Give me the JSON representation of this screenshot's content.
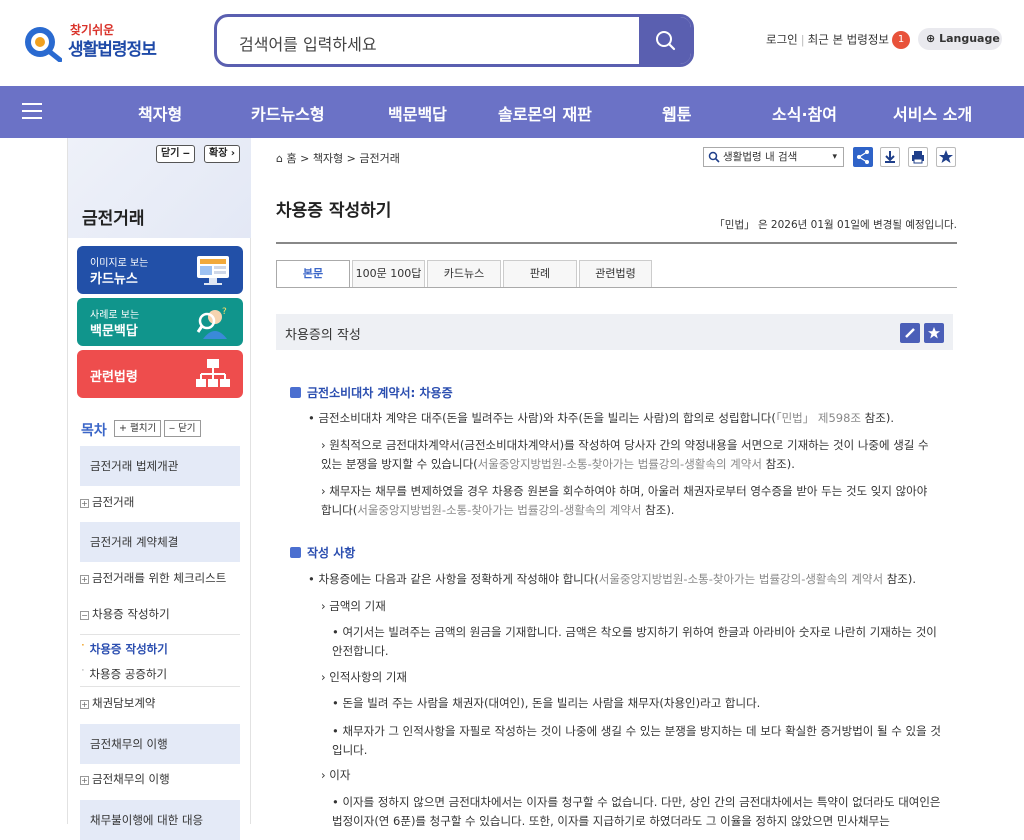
{
  "header": {
    "logo_top": "찾기쉬운",
    "logo_main": "생활법령정보",
    "search_placeholder": "검색어를 입력하세요",
    "login": "로그인",
    "recent": "최근 본 법령정보",
    "recent_count": "1",
    "language": "Language"
  },
  "nav": [
    "책자형",
    "카드뉴스형",
    "백문백답",
    "솔로몬의 재판",
    "웹툰",
    "소식·참여",
    "서비스 소개"
  ],
  "sidebar": {
    "close_label": "닫기 ‒",
    "expand_label": "확장 ›",
    "title": "금전거래",
    "cards": [
      {
        "small": "이미지로 보는",
        "big": "카드뉴스",
        "color": "#2250a8"
      },
      {
        "small": "사례로 보는",
        "big": "백문백답",
        "color": "#10958c"
      },
      {
        "small": "",
        "big": "관련법령",
        "color": "#ee4d4d"
      }
    ],
    "toc_label": "목차",
    "unfold_label": "+ 펼치기",
    "fold_label": "‒ 닫기",
    "sections": [
      "금전거래 법제개관",
      "금전거래 계약체결",
      "금전채무의 이행",
      "채무불이행에 대한 대응"
    ],
    "items": [
      "금전거래",
      "금전거래를 위한 체크리스트",
      "차용증 작성하기",
      "차용증 작성하기",
      "차용증 공증하기",
      "채권담보계약",
      "금전채무의 이행"
    ]
  },
  "main": {
    "breadcrumb": "홈 > 책자형 > 금전거래",
    "search_select": "생활법령 내 검색",
    "title": "차용증 작성하기",
    "notice": "「민법」 은 2026년 01월 01일에 변경될 예정입니다.",
    "tabs": [
      "본문",
      "100문 100답",
      "카드뉴스",
      "판례",
      "관련법령"
    ],
    "section_title": "차용증의 작성",
    "h_contract": "금전소비대차 계약서: 차용증",
    "p1": "금전소비대차 계약은 대주(돈을 빌려주는 사람)와 차주(돈을 빌리는 사람)의 합의로 성립합니다(",
    "p1_ref": "「민법」 제598조",
    "p1_end": " 참조).",
    "p2": "원칙적으로 금전대차계약서(금전소비대차계약서)를 작성하여 당사자 간의 약정내용을 서면으로 기재하는 것이 나중에 생길 수 있는 분쟁을 방지할 수 있습니다(",
    "p2_ref": "서울중앙지방법원-소통-찾아가는 법률강의-생활속의 계약서",
    "p2_end": " 참조).",
    "p3": "채무자는 채무를 변제하였을 경우 차용증 원본을 회수하여야 하며, 아울러 채권자로부터 영수증을 받아 두는 것도 잊지 않아야 합니다(",
    "p3_ref": "서울중앙지방법원-소통-찾아가는 법률강의-생활속의 계약서",
    "p3_end": " 참조).",
    "h_items": "작성 사항",
    "p4": "차용증에는 다음과 같은 사항을 정확하게 작성해야 합니다(",
    "p4_ref": "서울중앙지방법원-소통-찾아가는 법률강의-생활속의 계약서",
    "p4_end": " 참조).",
    "s1": "금액의 기재",
    "s1p": "여기서는 빌려주는 금액의 원금을 기재합니다. 금액은 착오를 방지하기 위하여 한글과 아라비아 숫자로 나란히 기재하는 것이 안전합니다.",
    "s2": "인적사항의 기재",
    "s2p1": "돈을 빌려 주는 사람을 채권자(대여인), 돈을 빌리는 사람을 채무자(차용인)라고 합니다.",
    "s2p2": "채무자가 그 인적사항을 자필로 작성하는 것이 나중에 생길 수 있는 분쟁을 방지하는 데 보다 확실한 증거방법이 될 수 있을 것입니다.",
    "s3": "이자",
    "s3p": "이자를 정하지 않으면 금전대차에서는 이자를 청구할 수 없습니다. 다만, 상인 간의 금전대차에서는 특약이 없더라도 대여인은 법정이자(연 6푼)를 청구할 수 있습니다. 또한, 이자를 지급하기로 하였더라도 그 이율을 정하지 않았으면 민사채무는"
  },
  "colors": {
    "accent": "#6b72c6",
    "search_border": "#5a5fb0",
    "link_blue": "#2b4eb0"
  }
}
